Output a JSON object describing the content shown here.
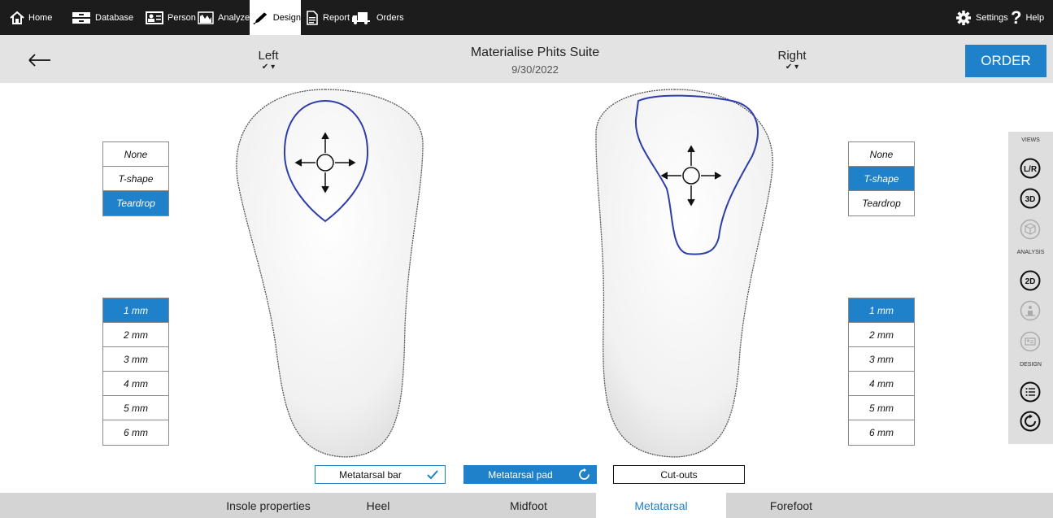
{
  "topbar": {
    "home": "Home",
    "database": "Database",
    "person": "Person",
    "analyze": "Analyze",
    "design": "Design",
    "report": "Report",
    "orders": "Orders",
    "settings": "Settings",
    "help": "Help"
  },
  "header": {
    "left_label": "Left",
    "right_label": "Right",
    "title": "Materialise Phits Suite",
    "date": "9/30/2022",
    "order_label": "ORDER",
    "check_glyph": "✔ ▾"
  },
  "left_shape_options": [
    {
      "label": "None",
      "selected": false
    },
    {
      "label": "T-shape",
      "selected": false
    },
    {
      "label": "Teardrop",
      "selected": true
    }
  ],
  "right_shape_options": [
    {
      "label": "None",
      "selected": false
    },
    {
      "label": "T-shape",
      "selected": true
    },
    {
      "label": "Teardrop",
      "selected": false
    }
  ],
  "left_thickness_options": [
    {
      "label": "1 mm",
      "selected": true
    },
    {
      "label": "2 mm"
    },
    {
      "label": "3 mm"
    },
    {
      "label": "4 mm"
    },
    {
      "label": "5 mm"
    },
    {
      "label": "6 mm"
    }
  ],
  "right_thickness_options": [
    {
      "label": "1 mm",
      "selected": true
    },
    {
      "label": "2 mm"
    },
    {
      "label": "3 mm"
    },
    {
      "label": "4 mm"
    },
    {
      "label": "5 mm"
    },
    {
      "label": "6 mm"
    }
  ],
  "actions": {
    "metatarsal_bar": "Metatarsal bar",
    "metatarsal_pad": "Metatarsal pad",
    "cutouts": "Cut-outs"
  },
  "tabs": [
    "Insole properties",
    "Heel",
    "Midfoot",
    "Metatarsal",
    "Forefoot"
  ],
  "active_tab": "Metatarsal",
  "right_panel": {
    "views": "VIEWS",
    "analysis": "ANALYSIS",
    "design": "DESIGN",
    "lr": "L/R",
    "three_d": "3D",
    "two_d": "2D"
  },
  "colors": {
    "accent": "#1e81c9",
    "topbar": "#1c1c1c",
    "outline": "#2d3ea8"
  }
}
